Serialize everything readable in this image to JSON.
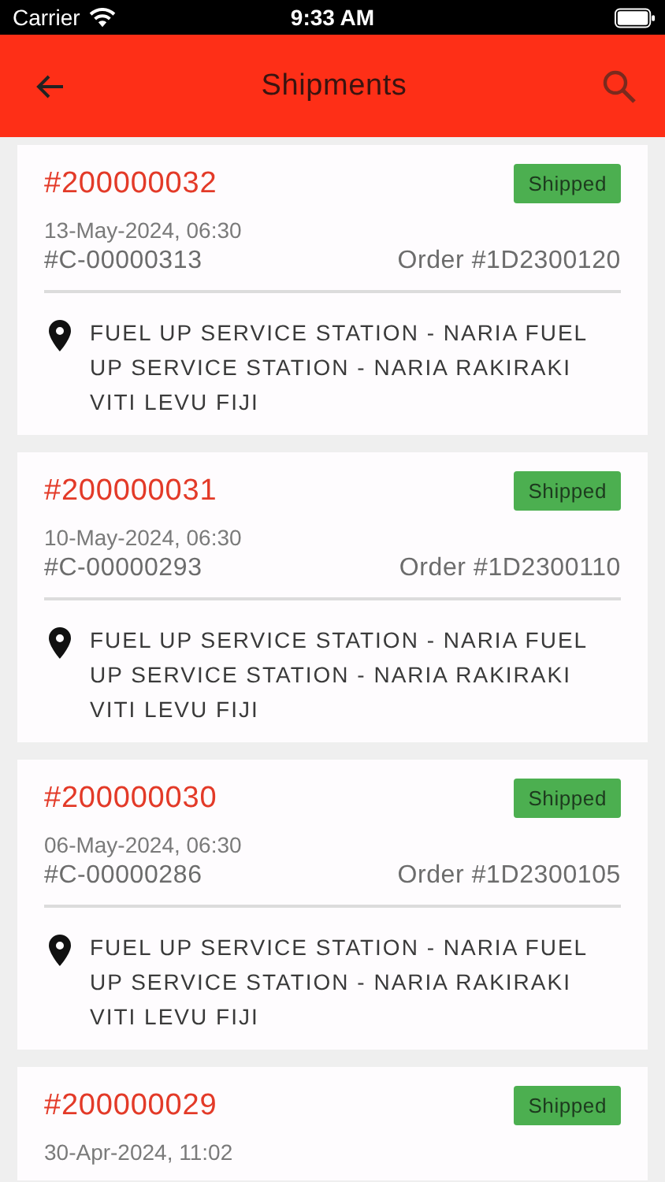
{
  "status_bar": {
    "carrier": "Carrier",
    "time": "9:33 AM"
  },
  "header": {
    "title": "Shipments"
  },
  "shipments": [
    {
      "number": "#200000032",
      "status": "Shipped",
      "date": "13-May-2024, 06:30",
      "customer": "#C-00000313",
      "order": "Order #1D2300120",
      "address": "FUEL UP SERVICE STATION - NARIA FUEL UP SERVICE STATION - NARIA RAKIRAKI VITI LEVU FIJI"
    },
    {
      "number": "#200000031",
      "status": "Shipped",
      "date": "10-May-2024, 06:30",
      "customer": "#C-00000293",
      "order": "Order #1D2300110",
      "address": "FUEL UP SERVICE STATION - NARIA FUEL UP SERVICE STATION - NARIA RAKIRAKI VITI LEVU FIJI"
    },
    {
      "number": "#200000030",
      "status": "Shipped",
      "date": "06-May-2024, 06:30",
      "customer": "#C-00000286",
      "order": "Order #1D2300105",
      "address": "FUEL UP SERVICE STATION - NARIA FUEL UP SERVICE STATION - NARIA RAKIRAKI VITI LEVU FIJI"
    },
    {
      "number": "#200000029",
      "status": "Shipped",
      "date": "30-Apr-2024, 11:02"
    }
  ]
}
